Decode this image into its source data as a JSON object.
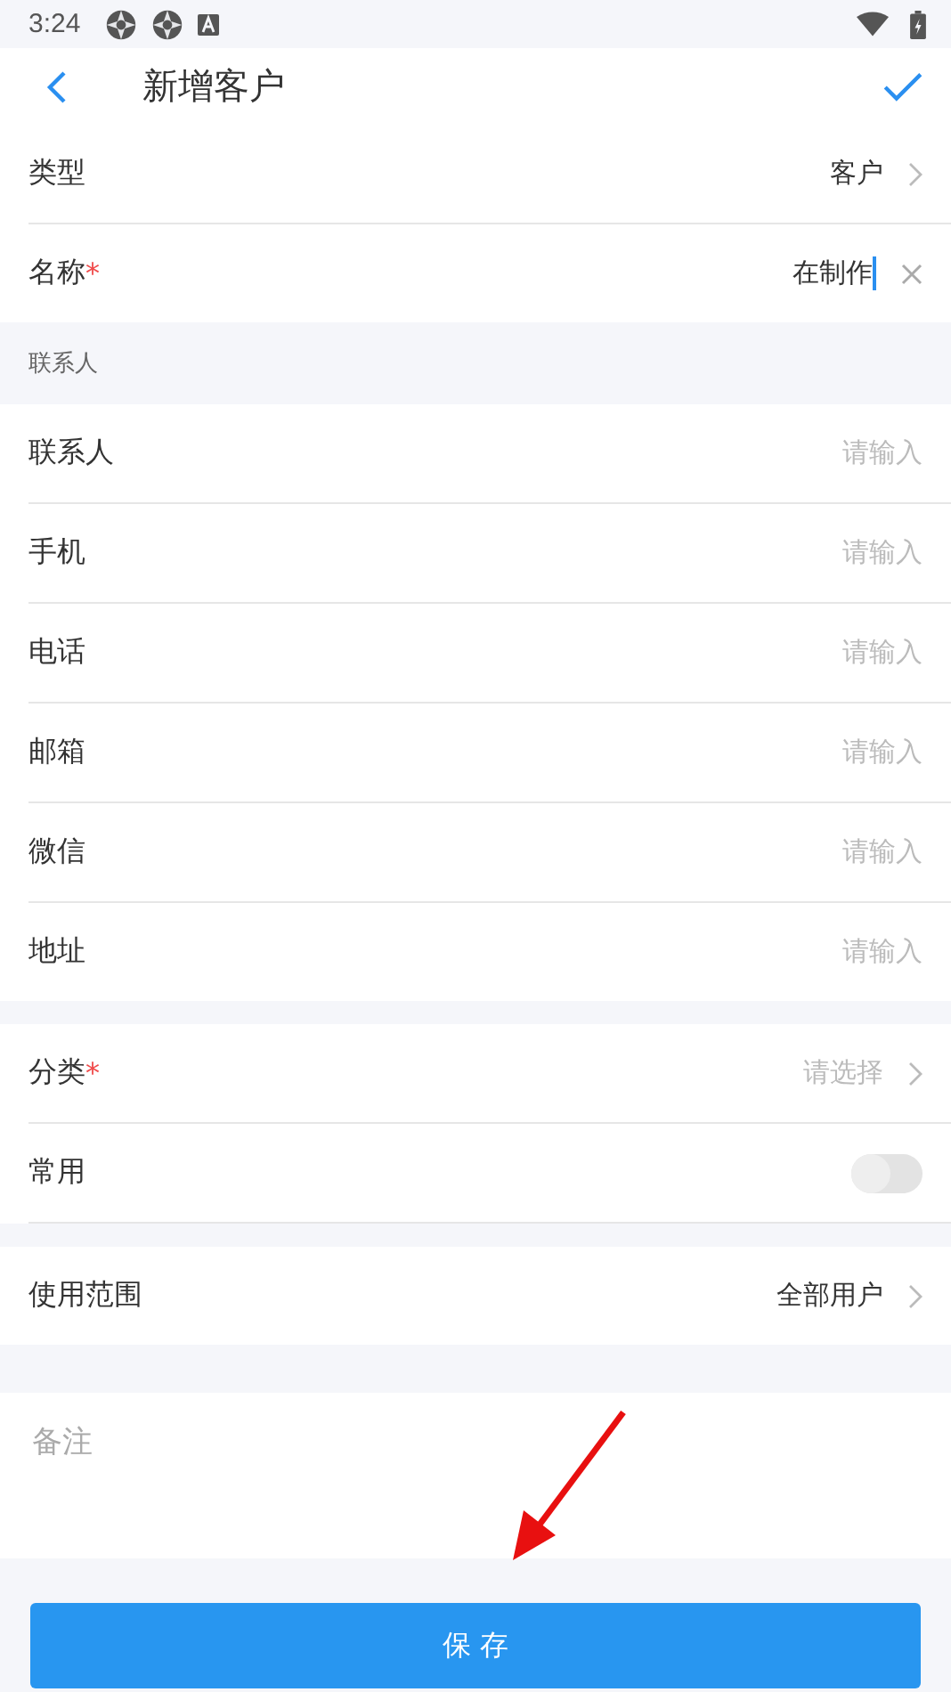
{
  "status_bar": {
    "time": "3:24"
  },
  "header": {
    "title": "新增客户"
  },
  "groups": [
    {
      "rows": [
        {
          "kind": "select",
          "label": "类型",
          "value": "客户"
        },
        {
          "kind": "text",
          "label": "名称",
          "required_mark": "*",
          "value": "在制作",
          "focused": true,
          "clearable": true
        }
      ]
    },
    {
      "title": "联系人",
      "rows": [
        {
          "kind": "text",
          "label": "联系人",
          "placeholder": "请输入"
        },
        {
          "kind": "text",
          "label": "手机",
          "placeholder": "请输入"
        },
        {
          "kind": "text",
          "label": "电话",
          "placeholder": "请输入"
        },
        {
          "kind": "text",
          "label": "邮箱",
          "placeholder": "请输入"
        },
        {
          "kind": "text",
          "label": "微信",
          "placeholder": "请输入"
        },
        {
          "kind": "text",
          "label": "地址",
          "placeholder": "请输入"
        }
      ]
    },
    {
      "rows": [
        {
          "kind": "select",
          "label": "分类",
          "required_mark": "*",
          "placeholder": "请选择"
        },
        {
          "kind": "switch",
          "label": "常用",
          "on": false
        }
      ]
    },
    {
      "rows": [
        {
          "kind": "select",
          "label": "使用范围",
          "value": "全部用户"
        }
      ]
    }
  ],
  "remarks": {
    "placeholder": "备注"
  },
  "save_button": "保 存"
}
